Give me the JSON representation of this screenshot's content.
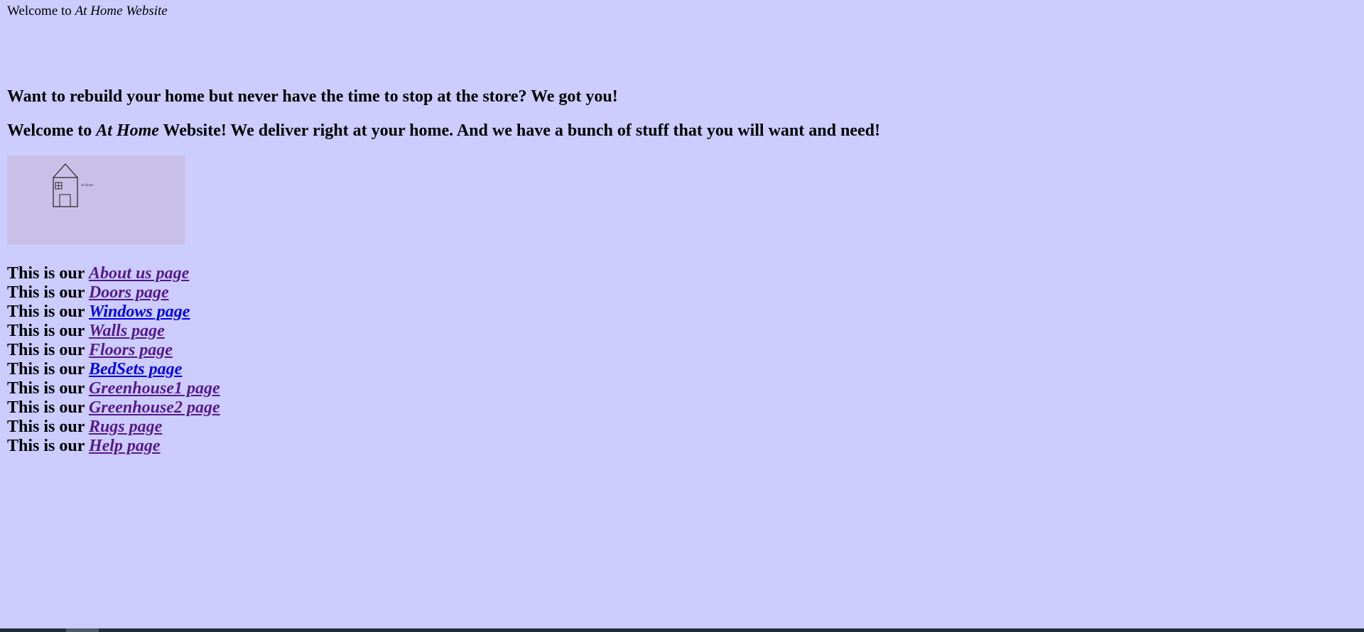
{
  "header": {
    "prefix": "Welcome to ",
    "site_name": "At Home Website"
  },
  "headline1": "Want to rebuild your home but never have the time to stop at the store? We got you!",
  "headline2": {
    "prefix": "Welcome to ",
    "site_name_italic": "At Home",
    "suffix": " Website! We deliver right at your home. And we have a bunch of stuff that you will want and need!"
  },
  "logo": {
    "icon": "house-icon",
    "caption": "At Home"
  },
  "links": [
    {
      "prefix": "This is our ",
      "label": "About us page",
      "visited": true
    },
    {
      "prefix": "This is our ",
      "label": "Doors page",
      "visited": true
    },
    {
      "prefix": "This is our ",
      "label": "Windows page",
      "visited": false
    },
    {
      "prefix": "This is our ",
      "label": "Walls page",
      "visited": true
    },
    {
      "prefix": "This is our ",
      "label": "Floors page",
      "visited": true
    },
    {
      "prefix": "This is our ",
      "label": "BedSets page",
      "visited": false
    },
    {
      "prefix": "This is our ",
      "label": "Greenhouse1 page",
      "visited": true
    },
    {
      "prefix": "This is our ",
      "label": "Greenhouse2 page",
      "visited": true
    },
    {
      "prefix": "This is our ",
      "label": "Rugs page",
      "visited": true
    },
    {
      "prefix": "This is our ",
      "label": "Help page",
      "visited": true
    }
  ],
  "colors": {
    "background": "#ccccff",
    "link_visited": "#551a8b",
    "link_unvisited": "#0000ee",
    "logo_background": "#c8c0e6"
  }
}
